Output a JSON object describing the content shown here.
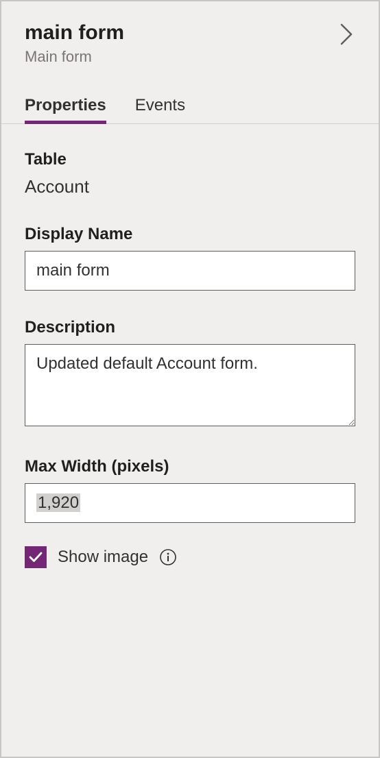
{
  "header": {
    "title": "main form",
    "subtitle": "Main form"
  },
  "tabs": {
    "properties": "Properties",
    "events": "Events"
  },
  "table": {
    "label": "Table",
    "value": "Account"
  },
  "displayName": {
    "label": "Display Name",
    "value": "main form"
  },
  "description": {
    "label": "Description",
    "value": "Updated default Account form."
  },
  "maxWidth": {
    "label": "Max Width (pixels)",
    "value": "1,920"
  },
  "showImage": {
    "label": "Show image",
    "checked": true
  },
  "colors": {
    "accent": "#742774"
  }
}
